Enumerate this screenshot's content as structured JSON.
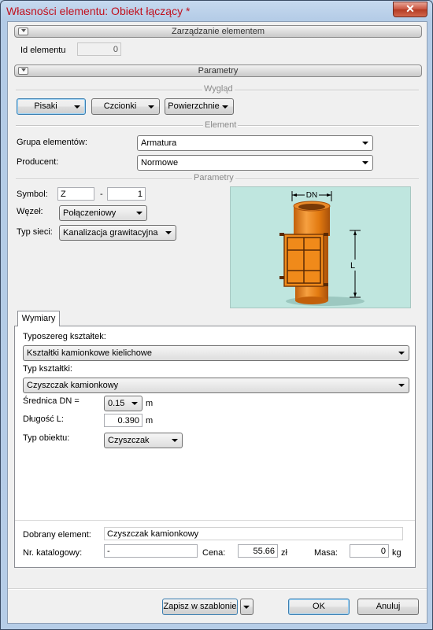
{
  "window": {
    "title": "Własności elementu: Obiekt łączący *"
  },
  "sections": {
    "management": "Zarządzanie elementem",
    "parameters": "Parametry"
  },
  "element_id": {
    "label": "Id elementu",
    "value": "0"
  },
  "appearance": {
    "title": "Wygląd",
    "pens": "Pisaki",
    "fonts": "Czcionki",
    "surfaces": "Powierzchnie"
  },
  "element": {
    "title": "Element",
    "group_label": "Grupa elementów:",
    "group_value": "Armatura",
    "producer_label": "Producent:",
    "producer_value": "Normowe"
  },
  "params": {
    "title": "Parametry",
    "symbol_label": "Symbol:",
    "symbol_value": "Z",
    "symbol_sep": "-",
    "symbol_number": "1",
    "node_label": "Węzeł:",
    "node_value": "Połączeniowy",
    "network_label": "Typ sieci:",
    "network_value": "Kanalizacja grawitacyjna",
    "image": {
      "dn_label": "DN",
      "l_label": "L",
      "pipe_color": "#f28c1c"
    }
  },
  "dimensions": {
    "tab_label": "Wymiary",
    "series_label": "Typoszereg kształtek:",
    "series_value": "Kształtki kamionkowe kielichowe",
    "fitting_type_label": "Typ kształtki:",
    "fitting_type_value": "Czyszczak kamionkowy",
    "dn_label": "Średnica DN =",
    "dn_value": "0.15",
    "dn_unit": "m",
    "length_label": "Długość L:",
    "length_value": "0.390",
    "length_unit": "m",
    "object_type_label": "Typ obiektu:",
    "object_type_value": "Czyszczak"
  },
  "selection": {
    "selected_label": "Dobrany element:",
    "selected_value": "Czyszczak kamionkowy",
    "catalog_label": "Nr. katalogowy:",
    "catalog_value": "-",
    "price_label": "Cena:",
    "price_value": "55.66",
    "price_unit": "zł",
    "mass_label": "Masa:",
    "mass_value": "0",
    "mass_unit": "kg"
  },
  "footer": {
    "save_template": "Zapisz w szablonie",
    "ok": "OK",
    "cancel": "Anuluj"
  }
}
